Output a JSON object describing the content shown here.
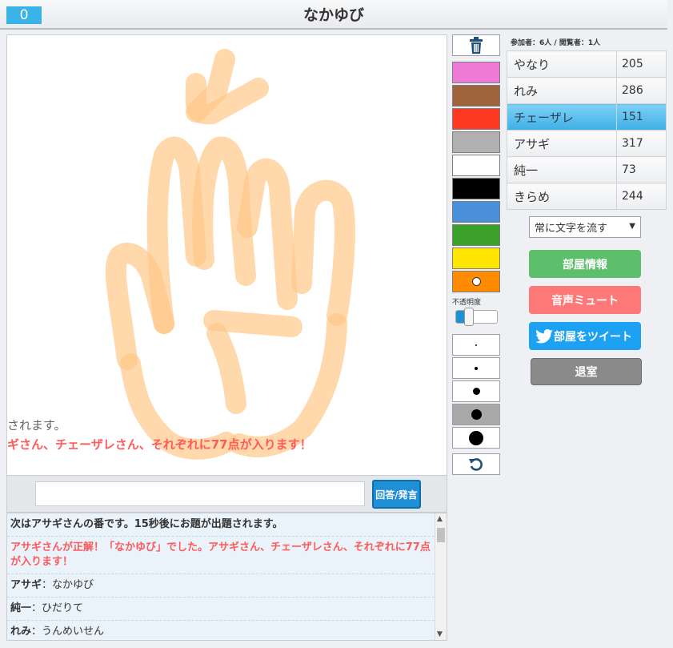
{
  "header": {
    "score": "0",
    "title": "なかゆび"
  },
  "canvas": {
    "flow_text_1": "されます。",
    "flow_text_2": "ギさん、チェーザレさん、それぞれに77点が入ります！"
  },
  "answer": {
    "value": "",
    "button_label": "回答/発言"
  },
  "chat": [
    {
      "text": "次はアサギさんの番です。15秒後にお題が出題されます。",
      "style": "system"
    },
    {
      "text": "アサギさんが正解！「なかゆび」でした。アサギさん、チェーザレさん、それぞれに77点が入ります！",
      "style": "red"
    },
    {
      "name": "アサギ",
      "message": "なかゆび"
    },
    {
      "name": "純一",
      "message": "ひだりて"
    },
    {
      "name": "れみ",
      "message": "うんめいせん"
    }
  ],
  "tools": {
    "colors": [
      "#ee7ad8",
      "#a0643c",
      "#ff3a22",
      "#b0b0b0",
      "#ffffff",
      "#000000",
      "#4a8fda",
      "#3aa02a",
      "#ffe600",
      "#ff8c00"
    ],
    "opacity_label": "不透明度",
    "opacity_value": 0.2,
    "icons": [
      "trash-icon",
      "undo-icon"
    ]
  },
  "participants": {
    "label": "参加者：6人 / 閲覧者：1人"
  },
  "players": [
    {
      "name": "やなり",
      "score": "205"
    },
    {
      "name": "れみ",
      "score": "286"
    },
    {
      "name": "チェーザレ",
      "score": "151",
      "active": true
    },
    {
      "name": "アサギ",
      "score": "317"
    },
    {
      "name": "純一",
      "score": "73"
    },
    {
      "name": "きらめ",
      "score": "244"
    }
  ],
  "controls": {
    "flow_select": "常に文字を流す",
    "room_info": "部屋情報",
    "mute": "音声ミュート",
    "tweet": "部屋をツイート",
    "leave": "退室"
  },
  "colors": {
    "accent": "#39b3e8",
    "red_text": "#ff5a5a",
    "room_info": "#5dbf6b",
    "mute": "#ff7878",
    "tweet": "#1da1f2",
    "leave": "#8a8a8a"
  }
}
